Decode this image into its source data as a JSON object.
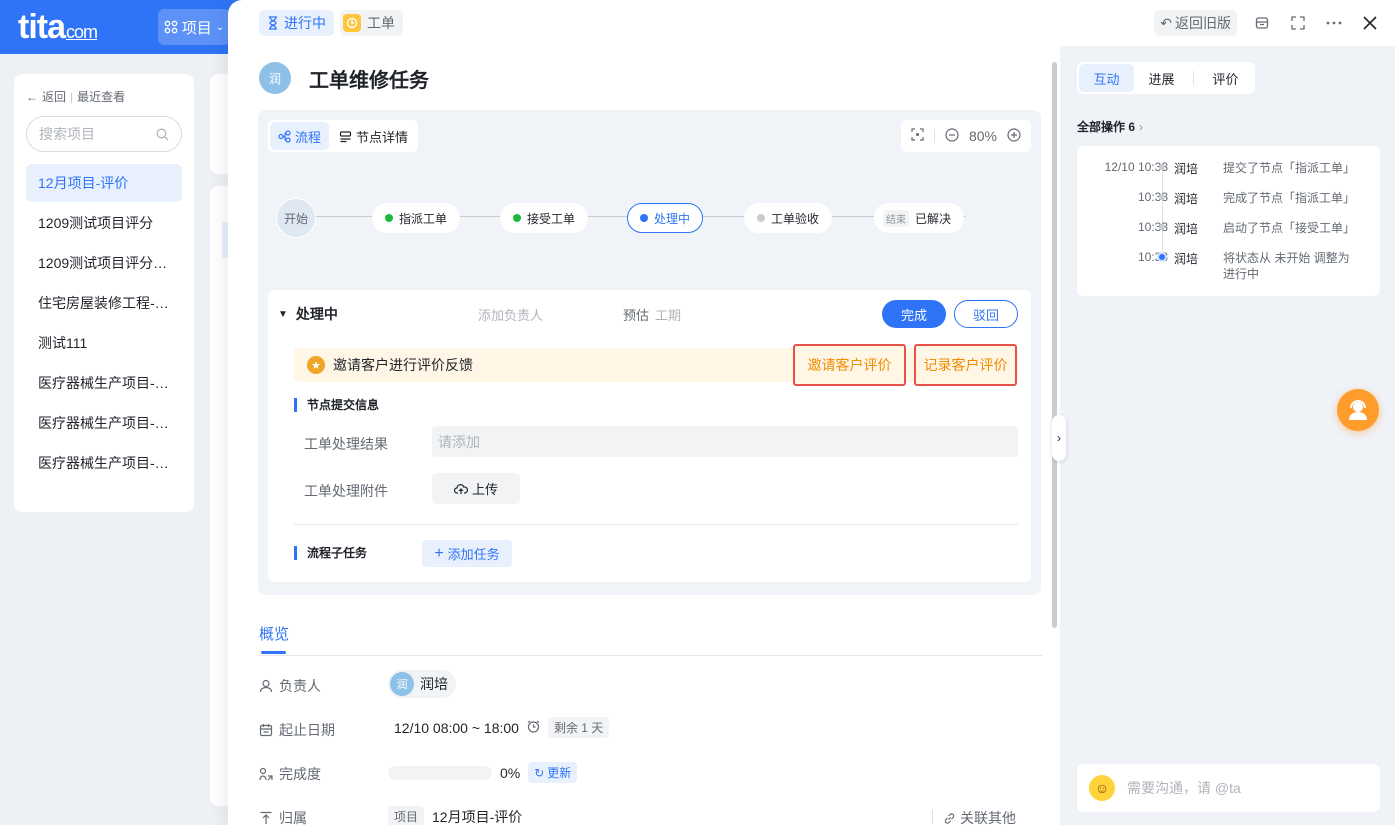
{
  "app": {
    "logo_text": "tita",
    "logo_suffix": "com",
    "project_menu_label": "项目"
  },
  "sidebar": {
    "back_label": "返回",
    "recent_label": "最近查看",
    "search_placeholder": "搜索项目",
    "items": [
      {
        "label": "12月项目-评价",
        "active": true
      },
      {
        "label": "1209测试项目评分"
      },
      {
        "label": "1209测试项目评分…"
      },
      {
        "label": "住宅房屋装修工程-…"
      },
      {
        "label": "测试111"
      },
      {
        "label": "医疗器械生产项目-…"
      },
      {
        "label": "医疗器械生产项目-…"
      },
      {
        "label": "医疗器械生产项目-…"
      }
    ]
  },
  "header": {
    "status_tag": "进行中",
    "type_tag": "工单",
    "revert_label": "返回旧版"
  },
  "task": {
    "avatar_text": "润",
    "title": "工单维修任务"
  },
  "flow": {
    "tab_flow": "流程",
    "tab_detail": "节点详情",
    "zoom": "80%",
    "nodes": [
      {
        "label": "开始"
      },
      {
        "label": "指派工单",
        "status_color": "#1fb83a"
      },
      {
        "label": "接受工单",
        "status_color": "#1fb83a"
      },
      {
        "label": "处理中",
        "status_color": "#2f74f6"
      },
      {
        "label": "工单验收",
        "status_color": "#c9ccd1"
      },
      {
        "label": "已解决",
        "end_tag": "结束"
      }
    ]
  },
  "node_panel": {
    "name": "处理中",
    "assignee_placeholder": "添加负责人",
    "estimate_label": "预估",
    "estimate_placeholder": "工期",
    "complete_button": "完成",
    "reject_button": "驳回",
    "invite_text": "邀请客户进行评价反馈",
    "invite_button": "邀请客户评价",
    "record_button": "记录客户评价",
    "submit_section": "节点提交信息",
    "result_label": "工单处理结果",
    "result_placeholder": "请添加",
    "attachment_label": "工单处理附件",
    "upload_button": "上传",
    "subtask_section": "流程子任务",
    "add_task_button": "添加任务"
  },
  "overview": {
    "tab_label": "概览",
    "owner_label": "负责人",
    "owner_avatar": "润",
    "owner_name": "润培",
    "date_label": "起止日期",
    "date_value": "12/10 08:00 ~ 18:00",
    "remaining": "剩余 1 天",
    "progress_label": "完成度",
    "progress_value": 0,
    "progress_text": "0%",
    "update_label": "更新",
    "belong_label": "归属",
    "belong_tag": "项目",
    "belong_value": "12月项目-评价",
    "link_other": "关联其他"
  },
  "right_panel": {
    "tabs": [
      {
        "label": "互动",
        "active": true
      },
      {
        "label": "进展"
      },
      {
        "label": "评价"
      }
    ],
    "ops_label": "全部操作 6",
    "logs": [
      {
        "time": "12/10 10:33",
        "user": "润培",
        "action": "提交了节点「指派工单」"
      },
      {
        "time": "10:33",
        "user": "润培",
        "action": "完成了节点「指派工单」"
      },
      {
        "time": "10:33",
        "user": "润培",
        "action": "启动了节点「接受工单」"
      },
      {
        "time": "10:33",
        "user": "润培",
        "action": "将状态从 未开始 调整为 进行中"
      }
    ],
    "chat_placeholder": "需要沟通，请 @ta"
  }
}
